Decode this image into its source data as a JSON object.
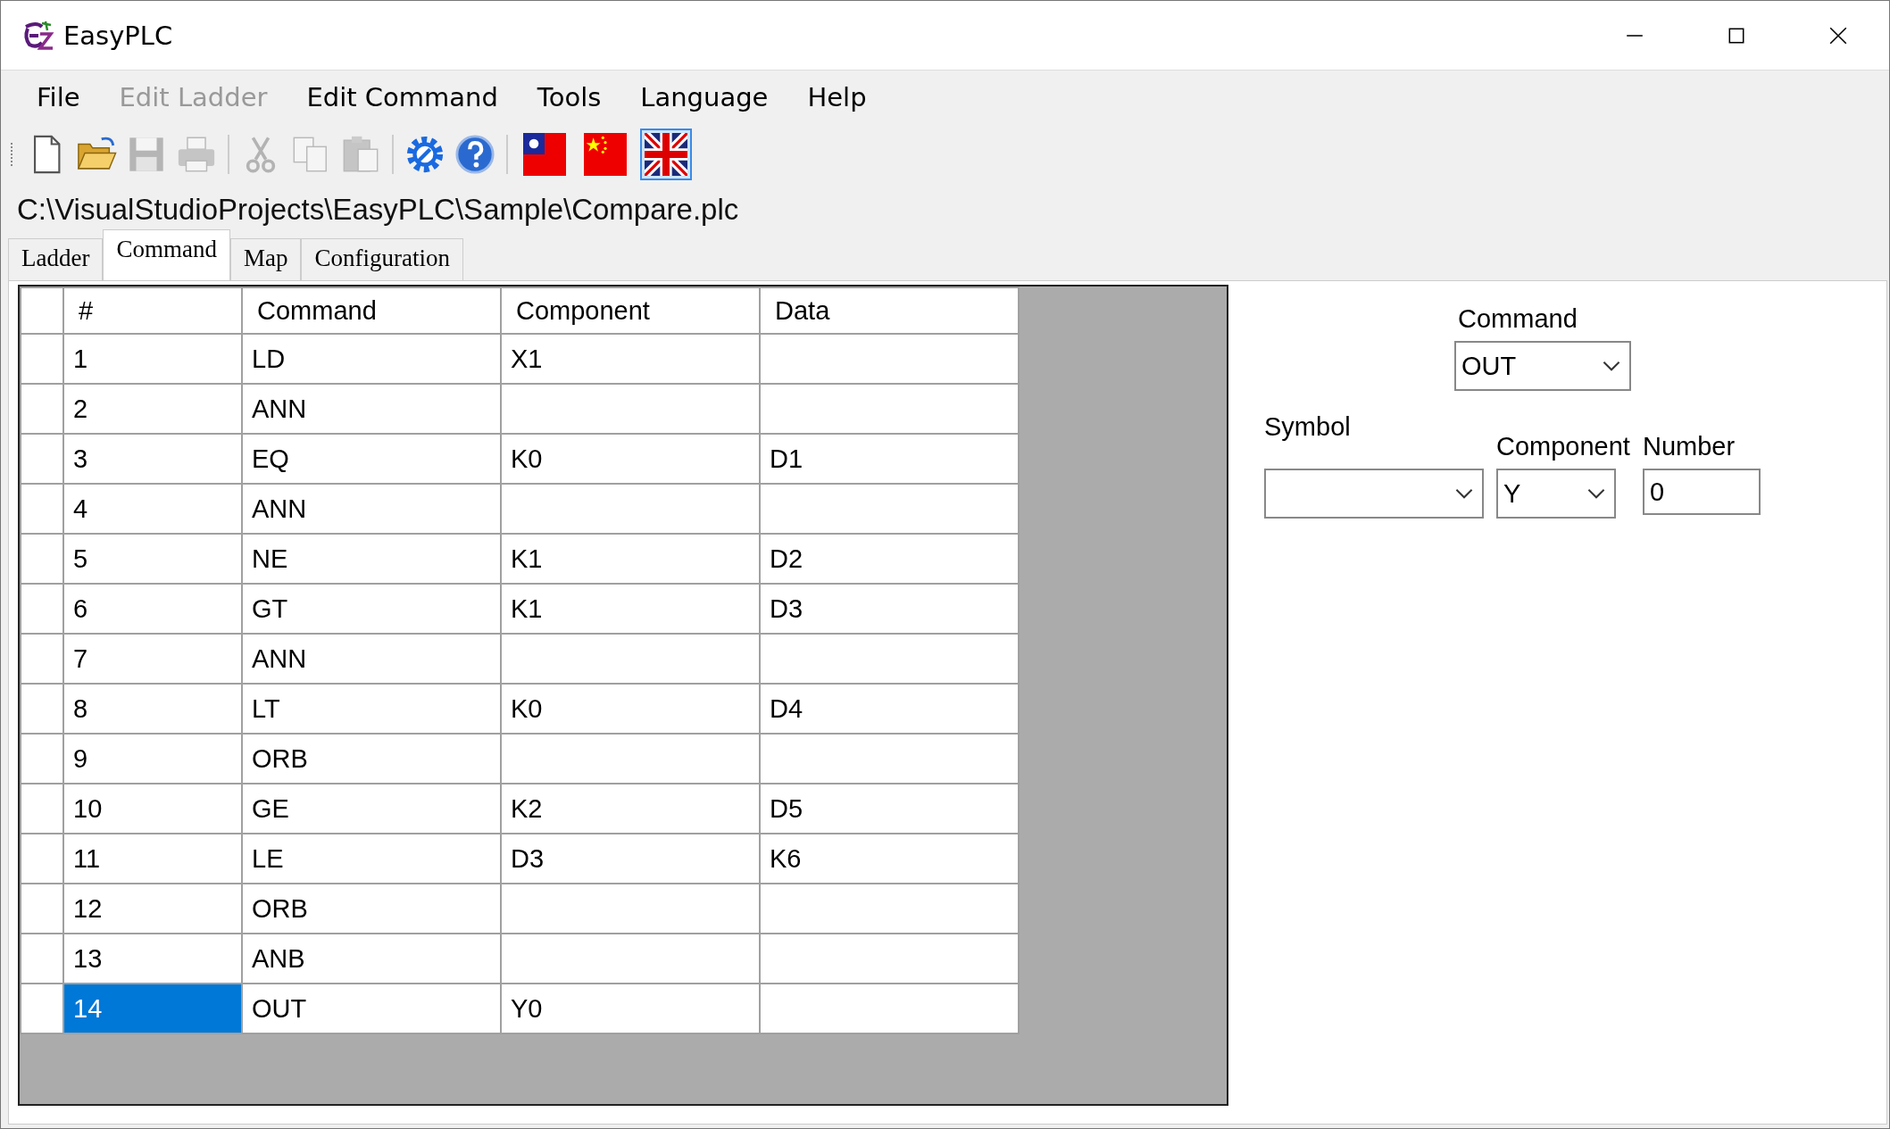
{
  "window": {
    "title": "EasyPLC"
  },
  "menu": [
    {
      "label": "File",
      "disabled": false
    },
    {
      "label": "Edit Ladder",
      "disabled": true
    },
    {
      "label": "Edit Command",
      "disabled": false
    },
    {
      "label": "Tools",
      "disabled": false
    },
    {
      "label": "Language",
      "disabled": false
    },
    {
      "label": "Help",
      "disabled": false
    }
  ],
  "toolbar": [
    {
      "kind": "new",
      "disabled": false
    },
    {
      "kind": "open",
      "disabled": false
    },
    {
      "kind": "save",
      "disabled": true
    },
    {
      "kind": "print",
      "disabled": true
    },
    {
      "kind": "sep"
    },
    {
      "kind": "cut",
      "disabled": true
    },
    {
      "kind": "copy",
      "disabled": true
    },
    {
      "kind": "paste",
      "disabled": true
    },
    {
      "kind": "sep"
    },
    {
      "kind": "settings",
      "disabled": false
    },
    {
      "kind": "help",
      "disabled": false
    },
    {
      "kind": "sep"
    },
    {
      "kind": "flag-tw",
      "selected": false
    },
    {
      "kind": "flag-cn",
      "selected": false
    },
    {
      "kind": "flag-uk",
      "selected": true
    }
  ],
  "file_path": "C:\\VisualStudioProjects\\EasyPLC\\Sample\\Compare.plc",
  "tabs": [
    {
      "label": "Ladder",
      "selected": false
    },
    {
      "label": "Command",
      "selected": true
    },
    {
      "label": "Map",
      "selected": false
    },
    {
      "label": "Configuration",
      "selected": false
    }
  ],
  "table": {
    "columns": [
      "#",
      "Command",
      "Component",
      "Data"
    ],
    "rows": [
      {
        "cells": [
          "1",
          "LD",
          "X1",
          ""
        ],
        "selected": false
      },
      {
        "cells": [
          "2",
          "ANN",
          "",
          ""
        ],
        "selected": false
      },
      {
        "cells": [
          "3",
          "EQ",
          "K0",
          "D1"
        ],
        "selected": false
      },
      {
        "cells": [
          "4",
          "ANN",
          "",
          ""
        ],
        "selected": false
      },
      {
        "cells": [
          "5",
          "NE",
          "K1",
          "D2"
        ],
        "selected": false
      },
      {
        "cells": [
          "6",
          "GT",
          "K1",
          "D3"
        ],
        "selected": false
      },
      {
        "cells": [
          "7",
          "ANN",
          "",
          ""
        ],
        "selected": false
      },
      {
        "cells": [
          "8",
          "LT",
          "K0",
          "D4"
        ],
        "selected": false
      },
      {
        "cells": [
          "9",
          "ORB",
          "",
          ""
        ],
        "selected": false
      },
      {
        "cells": [
          "10",
          "GE",
          "K2",
          "D5"
        ],
        "selected": false
      },
      {
        "cells": [
          "11",
          "LE",
          "D3",
          "K6"
        ],
        "selected": false
      },
      {
        "cells": [
          "12",
          "ORB",
          "",
          ""
        ],
        "selected": false
      },
      {
        "cells": [
          "13",
          "ANB",
          "",
          ""
        ],
        "selected": false
      },
      {
        "cells": [
          "14",
          "OUT",
          "Y0",
          ""
        ],
        "selected": true
      }
    ]
  },
  "form": {
    "command": {
      "label": "Command",
      "value": "OUT"
    },
    "symbol": {
      "label": "Symbol"
    },
    "component": {
      "label": "Component",
      "value": "Y"
    },
    "number": {
      "label": "Number",
      "value": "0"
    }
  }
}
